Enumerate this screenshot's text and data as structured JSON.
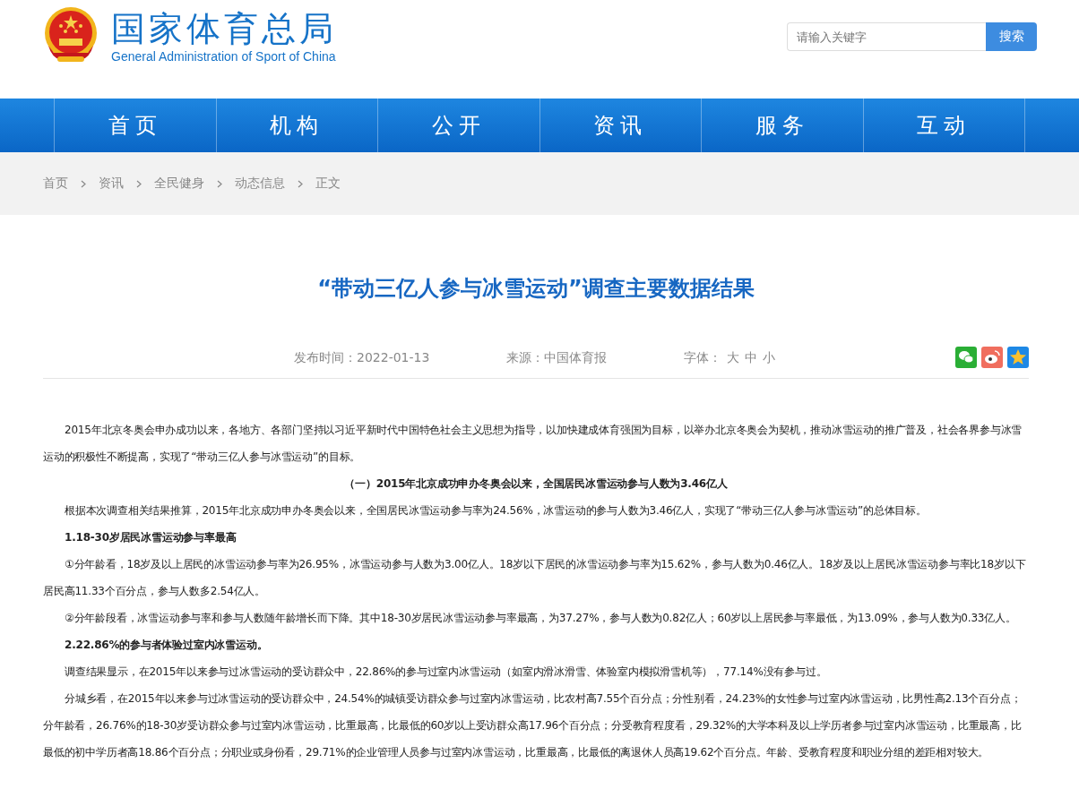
{
  "header": {
    "title": "国家体育总局",
    "subtitle": "General Administration of Sport of China",
    "search": {
      "placeholder": "请输入关键字",
      "button": "搜索"
    }
  },
  "nav": [
    "首页",
    "机构",
    "公开",
    "资讯",
    "服务",
    "互动"
  ],
  "breadcrumb": [
    "首页",
    "资讯",
    "全民健身",
    "动态信息",
    "正文"
  ],
  "article": {
    "title": "“带动三亿人参与冰雪运动”调查主要数据结果",
    "meta": {
      "date": "发布时间：2022-01-13",
      "source": "来源：中国体育报",
      "font_label": "字体：",
      "font_sizes": [
        "大",
        "中",
        "小"
      ]
    },
    "paragraphs": [
      {
        "kind": "body",
        "text": "2015年北京冬奥会申办成功以来，各地方、各部门坚持以习近平新时代中国特色社会主义思想为指导，以加快建成体育强国为目标，以举办北京冬奥会为契机，推动冰雪运动的推广普及，社会各界参与冰雪运动的积极性不断提高，实现了“带动三亿人参与冰雪运动”的目标。"
      },
      {
        "kind": "center",
        "text": "（一）2015年北京成功申办冬奥会以来，全国居民冰雪运动参与人数为3.46亿人"
      },
      {
        "kind": "body",
        "text": "根据本次调查相关结果推算，2015年北京成功申办冬奥会以来，全国居民冰雪运动参与率为24.56%，冰雪运动的参与人数为3.46亿人，实现了“带动三亿人参与冰雪运动”的总体目标。"
      },
      {
        "kind": "heading",
        "text": "1.18-30岁居民冰雪运动参与率最高"
      },
      {
        "kind": "body",
        "text": "①分年龄看，18岁及以上居民的冰雪运动参与率为26.95%，冰雪运动参与人数为3.00亿人。18岁以下居民的冰雪运动参与率为15.62%，参与人数为0.46亿人。18岁及以上居民冰雪运动参与率比18岁以下居民高11.33个百分点，参与人数多2.54亿人。"
      },
      {
        "kind": "body",
        "text": "②分年龄段看，冰雪运动参与率和参与人数随年龄增长而下降。其中18-30岁居民冰雪运动参与率最高，为37.27%，参与人数为0.82亿人；60岁以上居民参与率最低，为13.09%，参与人数为0.33亿人。"
      },
      {
        "kind": "heading",
        "text": "2.22.86%的参与者体验过室内冰雪运动。"
      },
      {
        "kind": "body",
        "text": "调查结果显示，在2015年以来参与过冰雪运动的受访群众中，22.86%的参与过室内冰雪运动（如室内滑冰滑雪、体验室内模拟滑雪机等），77.14%没有参与过。"
      },
      {
        "kind": "body",
        "text": "分城乡看，在2015年以来参与过冰雪运动的受访群众中，24.54%的城镇受访群众参与过室内冰雪运动，比农村高7.55个百分点；分性别看，24.23%的女性参与过室内冰雪运动，比男性高2.13个百分点；分年龄看，26.76%的18-30岁受访群众参与过室内冰雪运动，比重最高，比最低的60岁以上受访群众高17.96个百分点；分受教育程度看，29.32%的大学本科及以上学历者参与过室内冰雪运动，比重最高，比最低的初中学历者高18.86个百分点；分职业或身份看，29.71%的企业管理人员参与过室内冰雪运动，比重最高，比最低的离退休人员高19.62个百分点。年龄、受教育程度和职业分组的差距相对较大。"
      }
    ]
  }
}
